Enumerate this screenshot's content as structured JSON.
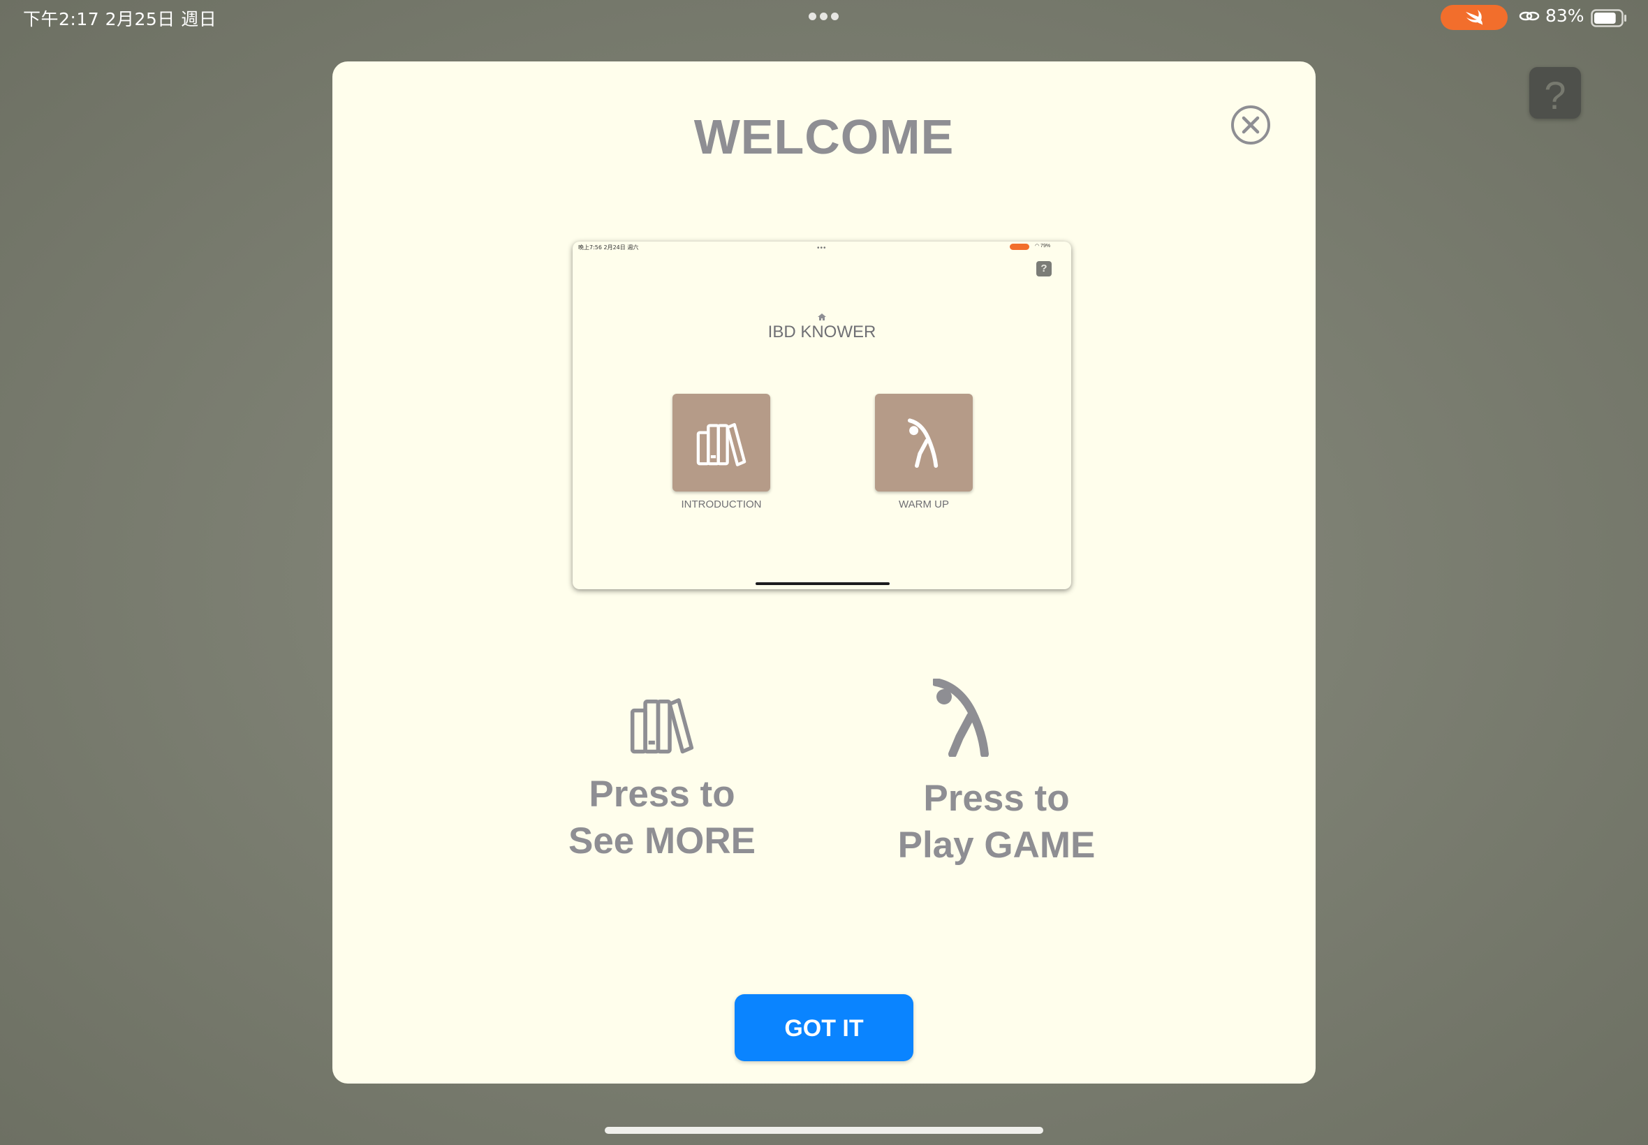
{
  "status_bar": {
    "time_date": "下午2:17   2月25日 週日",
    "battery_percent": "83%",
    "battery_level": 0.83
  },
  "background": {
    "help_label": "?"
  },
  "modal": {
    "title": "WELCOME",
    "preview": {
      "status_left": "晚上7:56   2月24日 週六",
      "status_dots": "•••",
      "status_battery": "◠ 79%",
      "help_label": "?",
      "title": "IBD KNOWER",
      "tiles": [
        {
          "label": "INTRODUCTION",
          "icon": "books-icon"
        },
        {
          "label": "WARM UP",
          "icon": "stretching-figure-icon"
        }
      ]
    },
    "instructions": [
      {
        "line1": "Press to",
        "line2": "See MORE",
        "icon": "books-icon"
      },
      {
        "line1": "Press to",
        "line2": "Play GAME",
        "icon": "stretching-figure-icon"
      }
    ],
    "got_it_label": "GOT IT"
  },
  "colors": {
    "modal_bg": "#fffeec",
    "text_gray": "#8e8e93",
    "tile_brown": "#b59b88",
    "button_blue": "#0a84ff",
    "swift_orange": "#f26e2c"
  }
}
